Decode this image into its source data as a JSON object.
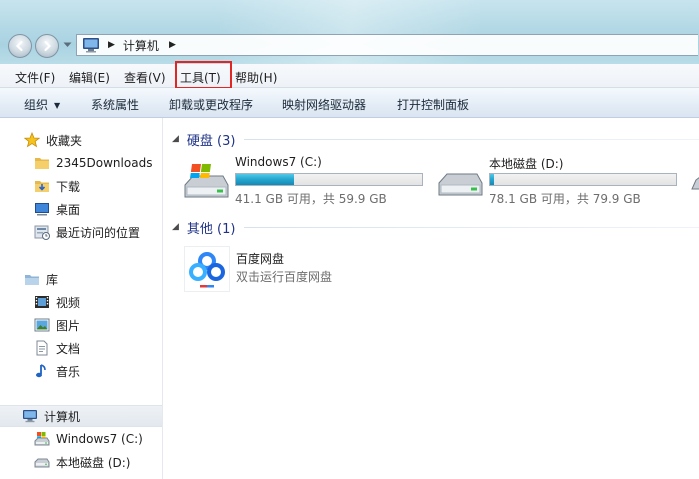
{
  "address": {
    "location": "计算机"
  },
  "menu": {
    "file": "文件(F)",
    "edit": "编辑(E)",
    "view": "查看(V)",
    "tools": "工具(T)",
    "help": "帮助(H)"
  },
  "commands": {
    "organize": "组织",
    "system_properties": "系统属性",
    "uninstall": "卸载或更改程序",
    "map_drive": "映射网络驱动器",
    "control_panel": "打开控制面板"
  },
  "nav": {
    "favorites": {
      "label": "收藏夹",
      "items": [
        "2345Downloads",
        "下载",
        "桌面",
        "最近访问的位置"
      ]
    },
    "libraries": {
      "label": "库",
      "items": [
        "视频",
        "图片",
        "文档",
        "音乐"
      ]
    },
    "computer": {
      "label": "计算机",
      "items": [
        "Windows7 (C:)",
        "本地磁盘 (D:)"
      ]
    }
  },
  "groups": {
    "hard_disks": {
      "label": "硬盘 (3)"
    },
    "other": {
      "label": "其他 (1)"
    }
  },
  "drives": [
    {
      "name": "Windows7 (C:)",
      "free_text": "41.1 GB 可用，共 59.9 GB",
      "used_fraction": 0.314
    },
    {
      "name": "本地磁盘 (D:)",
      "free_text": "78.1 GB 可用，共 79.9 GB",
      "used_fraction": 0.023
    }
  ],
  "other_items": [
    {
      "name": "百度网盘",
      "description": "双击运行百度网盘"
    }
  ],
  "colors": {
    "group_header": "#1e3287",
    "highlight_box": "#e12626",
    "drive_bar_fill": "#26a8d1",
    "baidu_blue": "#2f86f6"
  }
}
